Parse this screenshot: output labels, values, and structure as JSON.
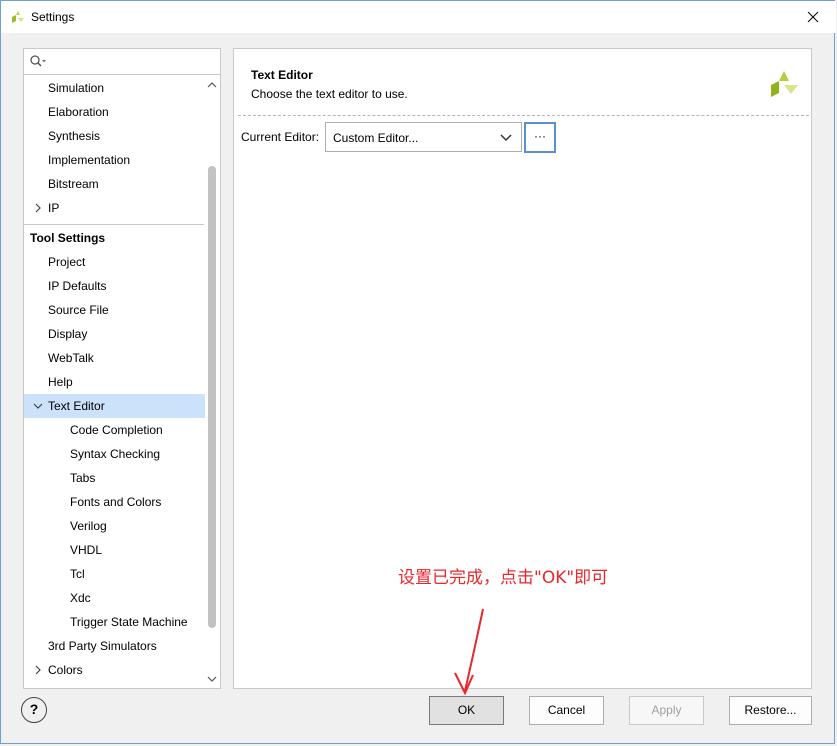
{
  "window": {
    "title": "Settings",
    "close_glyph": "✕",
    "brand_color": "#9abd1e"
  },
  "search": {
    "value": "",
    "placeholder": ""
  },
  "tree": {
    "items": [
      {
        "label": "Simulation",
        "indent": 1
      },
      {
        "label": "Elaboration",
        "indent": 1
      },
      {
        "label": "Synthesis",
        "indent": 1
      },
      {
        "label": "Implementation",
        "indent": 1
      },
      {
        "label": "Bitstream",
        "indent": 1
      },
      {
        "label": "IP",
        "indent": 1,
        "chevron": "right"
      },
      {
        "label": "Tool Settings",
        "header": true
      },
      {
        "label": "Project",
        "indent": 1
      },
      {
        "label": "IP Defaults",
        "indent": 1
      },
      {
        "label": "Source File",
        "indent": 1
      },
      {
        "label": "Display",
        "indent": 1
      },
      {
        "label": "WebTalk",
        "indent": 1
      },
      {
        "label": "Help",
        "indent": 1
      },
      {
        "label": "Text Editor",
        "indent": 1,
        "chevron": "down",
        "selected": true
      },
      {
        "label": "Code Completion",
        "indent": 2
      },
      {
        "label": "Syntax Checking",
        "indent": 2
      },
      {
        "label": "Tabs",
        "indent": 2
      },
      {
        "label": "Fonts and Colors",
        "indent": 2
      },
      {
        "label": "Verilog",
        "indent": 2
      },
      {
        "label": "VHDL",
        "indent": 2
      },
      {
        "label": "Tcl",
        "indent": 2
      },
      {
        "label": "Xdc",
        "indent": 2
      },
      {
        "label": "Trigger State Machine",
        "indent": 2
      },
      {
        "label": "3rd Party Simulators",
        "indent": 1
      },
      {
        "label": "Colors",
        "indent": 1,
        "chevron": "right"
      }
    ]
  },
  "panel": {
    "title": "Text Editor",
    "subtitle": "Choose the text editor to use.",
    "editor_label": "Current Editor:",
    "editor_value": "Custom Editor...",
    "browse_label": "···"
  },
  "annotation": {
    "text": "设置已完成，点击\"OK\"即可",
    "color": "#e8262b"
  },
  "buttons": {
    "help": "?",
    "ok": "OK",
    "cancel": "Cancel",
    "apply": "Apply",
    "restore": "Restore..."
  }
}
